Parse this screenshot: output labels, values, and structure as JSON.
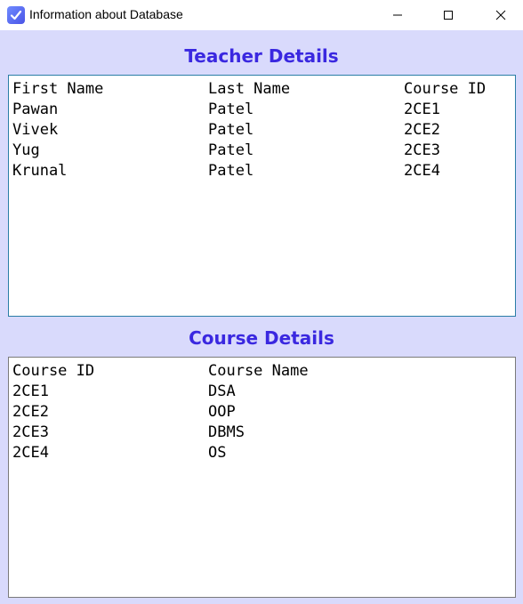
{
  "window": {
    "title": "Information about Database",
    "icon": "checkbox-icon",
    "accent": "#4a54e6"
  },
  "teacher_section": {
    "title": "Teacher Details",
    "columns": [
      "First Name",
      "Last Name",
      "Course ID"
    ],
    "rows": [
      [
        "Pawan",
        "Patel",
        "2CE1"
      ],
      [
        "Vivek",
        "Patel",
        "2CE2"
      ],
      [
        "Yug",
        "Patel",
        "2CE3"
      ],
      [
        "Krunal",
        "Patel",
        "2CE4"
      ]
    ]
  },
  "course_section": {
    "title": "Course Details",
    "columns": [
      "Course ID",
      "Course Name"
    ],
    "rows": [
      [
        "2CE1",
        "DSA"
      ],
      [
        "2CE2",
        "OOP"
      ],
      [
        "2CE3",
        "DBMS"
      ],
      [
        "2CE4",
        "OS"
      ]
    ]
  },
  "colors": {
    "background": "#d9dafc",
    "heading": "#3a28e0"
  }
}
